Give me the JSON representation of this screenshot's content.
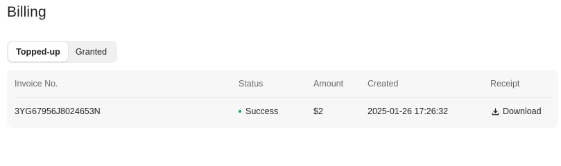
{
  "page": {
    "title": "Billing"
  },
  "tabs": [
    {
      "label": "Topped-up",
      "active": true
    },
    {
      "label": "Granted",
      "active": false
    }
  ],
  "table": {
    "columns": [
      "Invoice No.",
      "Status",
      "Amount",
      "Created",
      "Receipt"
    ],
    "rows": [
      {
        "invoice_no": "3YG67956J8024653N",
        "status": "Success",
        "amount": "$2",
        "created": "2025-01-26 17:26:32",
        "receipt": "Download"
      }
    ]
  },
  "colors": {
    "status_success": "#22a35a",
    "card_background": "#f7f7f7"
  },
  "icons": {
    "receipt_download": "download-icon"
  }
}
